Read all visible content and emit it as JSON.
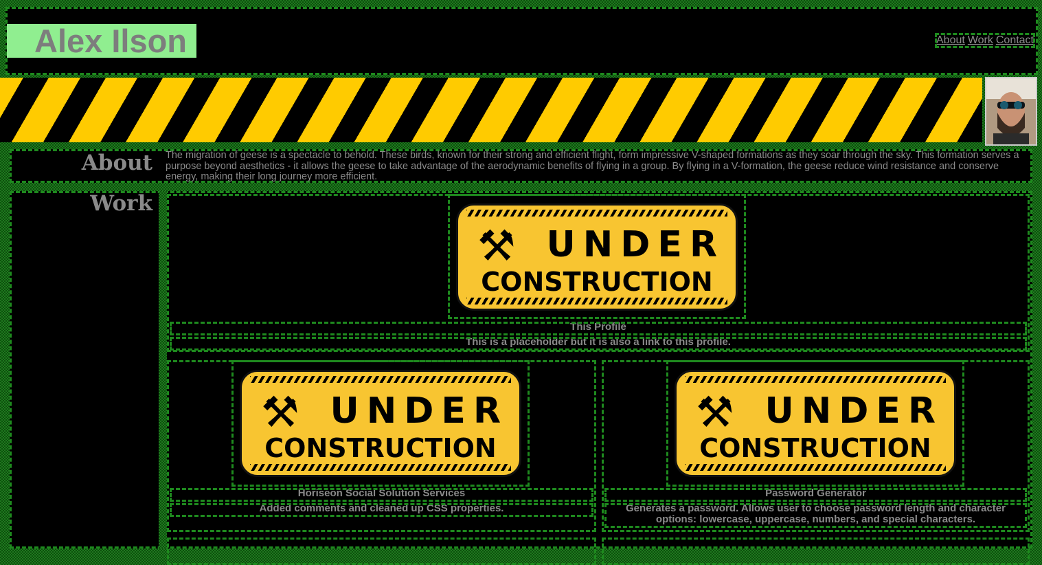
{
  "header": {
    "site_name": "Alex Ilson",
    "nav": [
      "About",
      "Work",
      "Contact"
    ]
  },
  "about": {
    "title": "About",
    "text": "The migration of geese is a spectacle to behold. These birds, known for their strong and efficient flight, form impressive V-shaped formations as they soar through the sky. This formation serves a purpose beyond aesthetics - it allows the geese to take advantage of the aerodynamic benefits of flying in a group. By flying in a V-formation, the geese reduce wind resistance and conserve energy, making their long journey more efficient."
  },
  "work": {
    "title": "Work",
    "projects": [
      {
        "title": "This Profile",
        "description": "This is a placeholder but it is also a link to this profile.",
        "image_word1": "UNDER",
        "image_word2": "CONSTRUCTION"
      },
      {
        "title": "Horiseon Social Solution Services",
        "description": "Added comments and cleaned up CSS properties.",
        "image_word1": "UNDER",
        "image_word2": "CONSTRUCTION"
      },
      {
        "title": "Password Generator",
        "description": "Generates a password. Allows user to choose password length and character options: lowercase, uppercase, numbers, and special characters.",
        "image_word1": "UNDER",
        "image_word2": "CONSTRUCTION"
      }
    ]
  },
  "colors": {
    "page_green": "#1f7a1f",
    "name_bg": "#90ee90",
    "hazard_yellow": "#ffcb00",
    "sign_yellow": "#f8c531"
  },
  "icons": [
    "tools-icon",
    "profile-photo"
  ]
}
